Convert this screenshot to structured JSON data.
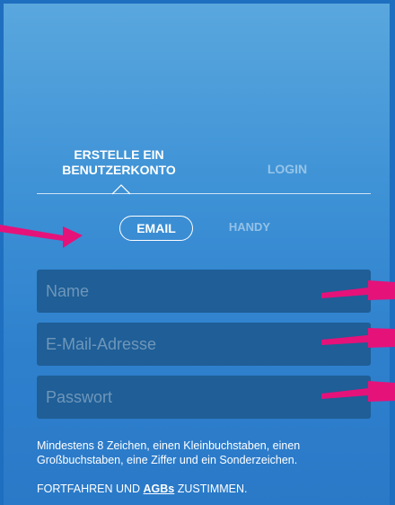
{
  "tabs": {
    "signup_label": "ERSTELLE EIN BENUTZERKONTO",
    "login_label": "LOGIN"
  },
  "method": {
    "email_label": "EMAIL",
    "phone_label": "HANDY"
  },
  "form": {
    "name_placeholder": "Name",
    "email_placeholder": "E-Mail-Adresse",
    "password_placeholder": "Passwort"
  },
  "hint": "Mindestens 8 Zeichen, einen Kleinbuchstaben, einen Großbuchstaben, eine Ziffer und ein Sonderzeichen.",
  "terms": {
    "prefix": "FORTFAHREN UND ",
    "link": "AGBs",
    "suffix": " ZUSTIMMEN."
  },
  "colors": {
    "background_top": "#5aa7de",
    "background_bottom": "#2a79c8",
    "field_bg": "#1f5e96",
    "annotation_arrow": "#e5127a"
  }
}
